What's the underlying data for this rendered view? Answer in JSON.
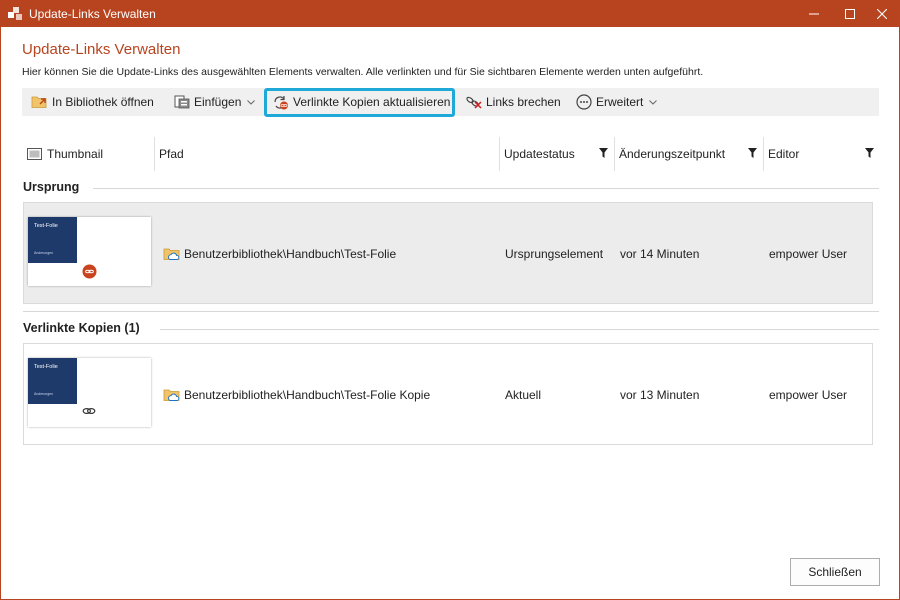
{
  "window": {
    "title": "Update-Links Verwalten",
    "accent_color": "#b8441f"
  },
  "header": {
    "heading": "Update-Links Verwalten",
    "description": "Hier können Sie die Update-Links des ausgewählten Elements verwalten. Alle verlinkten und für Sie sichtbaren Elemente werden unten aufgeführt."
  },
  "toolbar": {
    "open_library": "In Bibliothek öffnen",
    "insert": "Einfügen",
    "update_linked": "Verlinkte Kopien aktualisieren",
    "break_links": "Links brechen",
    "advanced": "Erweitert",
    "highlight_color": "#1ea9d8"
  },
  "columns": {
    "thumbnail": "Thumbnail",
    "path": "Pfad",
    "status": "Updatestatus",
    "changed": "Änderungszeitpunkt",
    "editor": "Editor"
  },
  "groups": {
    "origin": {
      "label": "Ursprung",
      "row": {
        "thumb_title": "Test-Folie",
        "thumb_sub": "Änderungen",
        "path": "Benutzerbibliothek\\Handbuch\\Test-Folie",
        "status": "Ursprungselement",
        "changed": "vor 14 Minuten",
        "editor": "empower User"
      }
    },
    "copies": {
      "label": "Verlinkte Kopien (1)",
      "row": {
        "thumb_title": "Test-Folie",
        "thumb_sub": "Änderungen",
        "path": "Benutzerbibliothek\\Handbuch\\Test-Folie Kopie",
        "status": "Aktuell",
        "changed": "vor 13 Minuten",
        "editor": "empower User"
      }
    }
  },
  "footer": {
    "close_label": "Schließen"
  }
}
